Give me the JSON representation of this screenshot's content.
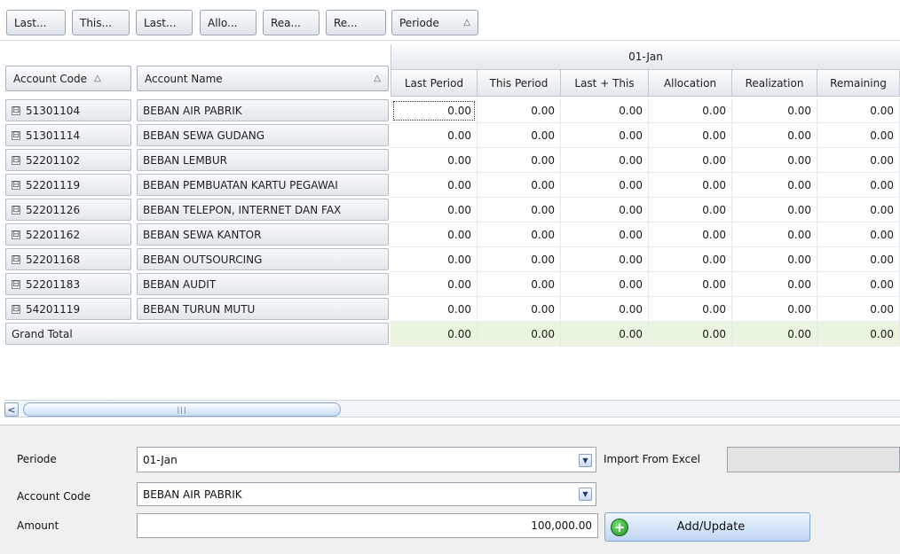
{
  "filter_buttons": [
    "Last...",
    "This...",
    "Last...",
    "Allo...",
    "Rea...",
    "Re..."
  ],
  "periode_filter": {
    "label": "Periode",
    "sort": "△"
  },
  "row_headers": {
    "account_code": {
      "label": "Account Code",
      "sort": "△"
    },
    "account_name": {
      "label": "Account Name",
      "sort": "△"
    }
  },
  "column_group": "01-Jan",
  "columns": [
    "Last Period",
    "This Period",
    "Last + This",
    "Allocation",
    "Realization",
    "Remaining"
  ],
  "rows": [
    {
      "code": "51301104",
      "name": "BEBAN AIR PABRIK",
      "values": [
        "0.00",
        "0.00",
        "0.00",
        "0.00",
        "0.00",
        "0.00"
      ]
    },
    {
      "code": "51301114",
      "name": "BEBAN SEWA GUDANG",
      "values": [
        "0.00",
        "0.00",
        "0.00",
        "0.00",
        "0.00",
        "0.00"
      ]
    },
    {
      "code": "52201102",
      "name": "BEBAN LEMBUR",
      "values": [
        "0.00",
        "0.00",
        "0.00",
        "0.00",
        "0.00",
        "0.00"
      ]
    },
    {
      "code": "52201119",
      "name": "BEBAN PEMBUATAN KARTU PEGAWAI",
      "values": [
        "0.00",
        "0.00",
        "0.00",
        "0.00",
        "0.00",
        "0.00"
      ]
    },
    {
      "code": "52201126",
      "name": "BEBAN TELEPON, INTERNET DAN FAX",
      "values": [
        "0.00",
        "0.00",
        "0.00",
        "0.00",
        "0.00",
        "0.00"
      ]
    },
    {
      "code": "52201162",
      "name": "BEBAN SEWA KANTOR",
      "values": [
        "0.00",
        "0.00",
        "0.00",
        "0.00",
        "0.00",
        "0.00"
      ]
    },
    {
      "code": "52201168",
      "name": "BEBAN OUTSOURCING",
      "values": [
        "0.00",
        "0.00",
        "0.00",
        "0.00",
        "0.00",
        "0.00"
      ]
    },
    {
      "code": "52201183",
      "name": "BEBAN AUDIT",
      "values": [
        "0.00",
        "0.00",
        "0.00",
        "0.00",
        "0.00",
        "0.00"
      ]
    },
    {
      "code": "54201119",
      "name": "BEBAN TURUN MUTU",
      "values": [
        "0.00",
        "0.00",
        "0.00",
        "0.00",
        "0.00",
        "0.00"
      ]
    }
  ],
  "grand_total": {
    "label": "Grand Total",
    "values": [
      "0.00",
      "0.00",
      "0.00",
      "0.00",
      "0.00",
      "0.00"
    ]
  },
  "scrollbar": {
    "left_arrow": "<",
    "grip": "|||"
  },
  "form": {
    "periode_label": "Periode",
    "periode_value": "01-Jan",
    "account_code_label": "Account Code",
    "account_code_value": "BEBAN AIR PABRIK",
    "amount_label": "Amount",
    "amount_value": "100,000.00",
    "import_label": "Import From Excel",
    "import_value": "",
    "add_update_label": "Add/Update"
  },
  "icons": {
    "expand": "⊟",
    "dropdown": "▼",
    "plus": "+"
  }
}
